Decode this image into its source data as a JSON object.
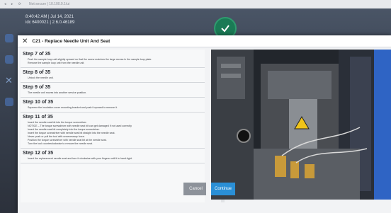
{
  "browser": {
    "nav": "◂ ▸ ⟳",
    "url": "Not secure | 10.100.0.1/ui"
  },
  "status": {
    "time_line": "8:40:42 AM | Jul 14, 2021",
    "version_line": "idc 6400021 | 2.6.0.46189"
  },
  "dialog": {
    "title": "C21 - Replace Needle Unit And Seat"
  },
  "steps": [
    {
      "title": "Step 7 of 35",
      "lines": [
        "Push the sample loop unit slightly upward so that the screw matches the large recess in the sample loop plate.",
        "Remove the sample loop unit from the needle unit."
      ]
    },
    {
      "title": "Step 8 of 35",
      "lines": [
        "Unlock the needle unit."
      ]
    },
    {
      "title": "Step 9 of 35",
      "lines": [
        "The needle unit moves into another service position."
      ]
    },
    {
      "title": "Step 10 of 35",
      "lines": [
        "Squeeze the insulation cover mounting bracket and push it upward to remove it."
      ]
    },
    {
      "title": "Step 11 of 35",
      "lines": [
        "Insert the needle seat bit into the torque screwdriver.",
        "NOTICE – The torque screwdriver with needle seat bit can get damaged if not used correctly",
        "Insert the needle seat bit completely into the torque screwdriver.",
        "Insert the torque screwdriver with needle seat bit straight into the needle seat.",
        "Never push or pull the tool with unnecessary force.",
        "Position the torque screwdriver with needle seat bit at the needle seat.",
        "Turn the tool counterclockwise to remove the needle seat."
      ]
    },
    {
      "title": "Step 12 of 35",
      "lines": [
        "Insert the replacement needle seat and turn it clockwise with your fingers until it is hand-tight."
      ]
    }
  ],
  "buttons": {
    "cancel": "Cancel",
    "continue": "Continue"
  },
  "colors": {
    "accent": "#2a8fd6",
    "status_ok": "#1a7a55"
  }
}
